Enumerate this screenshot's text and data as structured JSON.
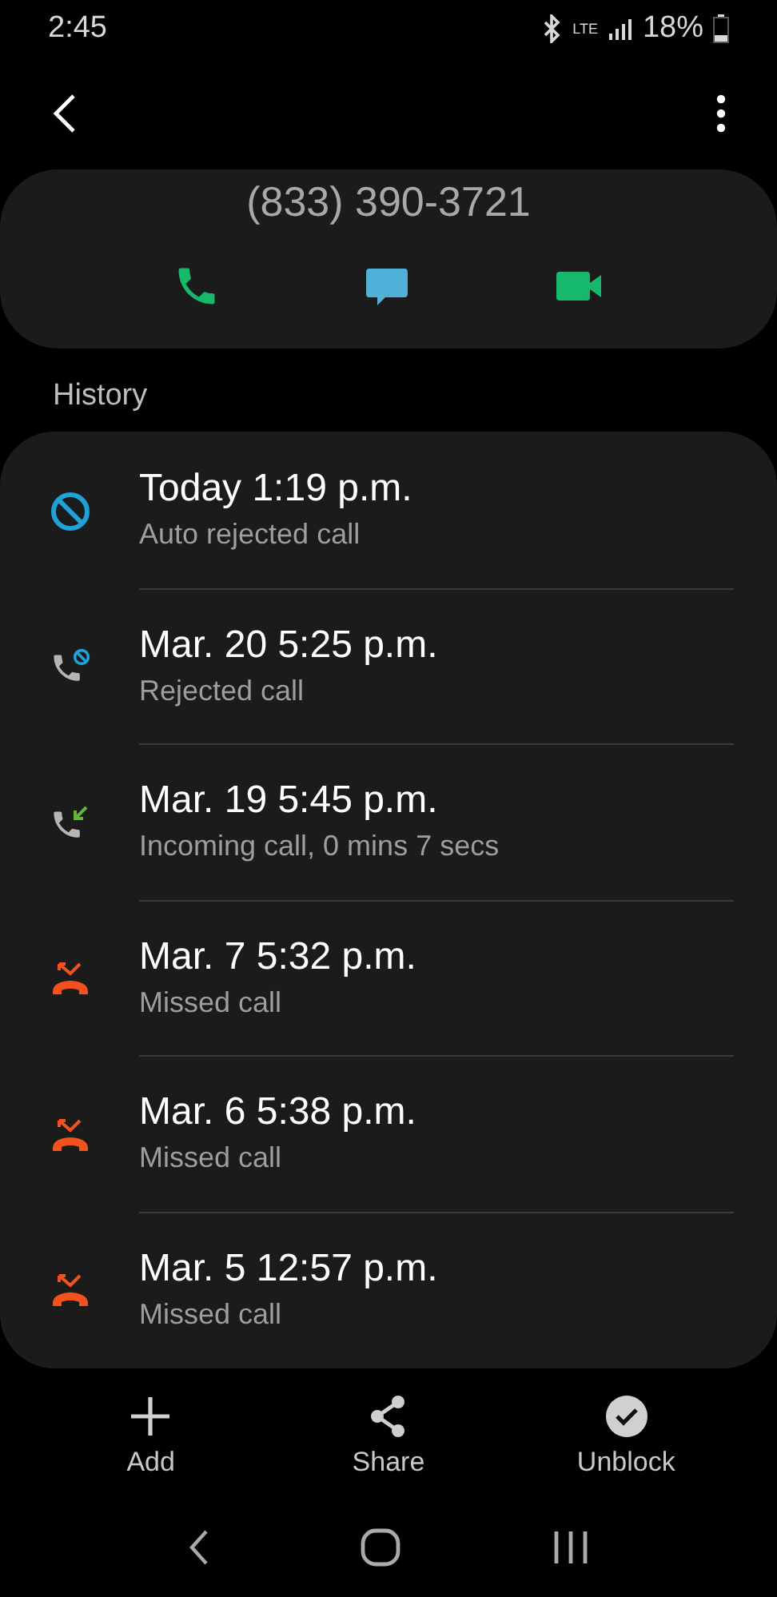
{
  "status_bar": {
    "time": "2:45",
    "network": "LTE",
    "battery": "18%"
  },
  "contact": {
    "number": "(833) 390-3721",
    "actions": [
      {
        "kind": "call"
      },
      {
        "kind": "message"
      },
      {
        "kind": "video"
      }
    ]
  },
  "history": {
    "title": "History",
    "calls": [
      {
        "kind": "auto_rejected",
        "time": "Today 1:19 p.m.",
        "detail": "Auto rejected call"
      },
      {
        "kind": "rejected",
        "time": "Mar. 20 5:25 p.m.",
        "detail": "Rejected call"
      },
      {
        "kind": "incoming",
        "time": "Mar. 19 5:45 p.m.",
        "detail": "Incoming call, 0 mins 7 secs"
      },
      {
        "kind": "missed",
        "time": "Mar. 7 5:32 p.m.",
        "detail": "Missed call"
      },
      {
        "kind": "missed",
        "time": "Mar. 6 5:38 p.m.",
        "detail": "Missed call"
      },
      {
        "kind": "missed",
        "time": "Mar. 5 12:57 p.m.",
        "detail": "Missed call"
      }
    ]
  },
  "bottom_actions": [
    {
      "kind": "add",
      "label": "Add"
    },
    {
      "kind": "share",
      "label": "Share"
    },
    {
      "kind": "unblock",
      "label": "Unblock"
    }
  ]
}
